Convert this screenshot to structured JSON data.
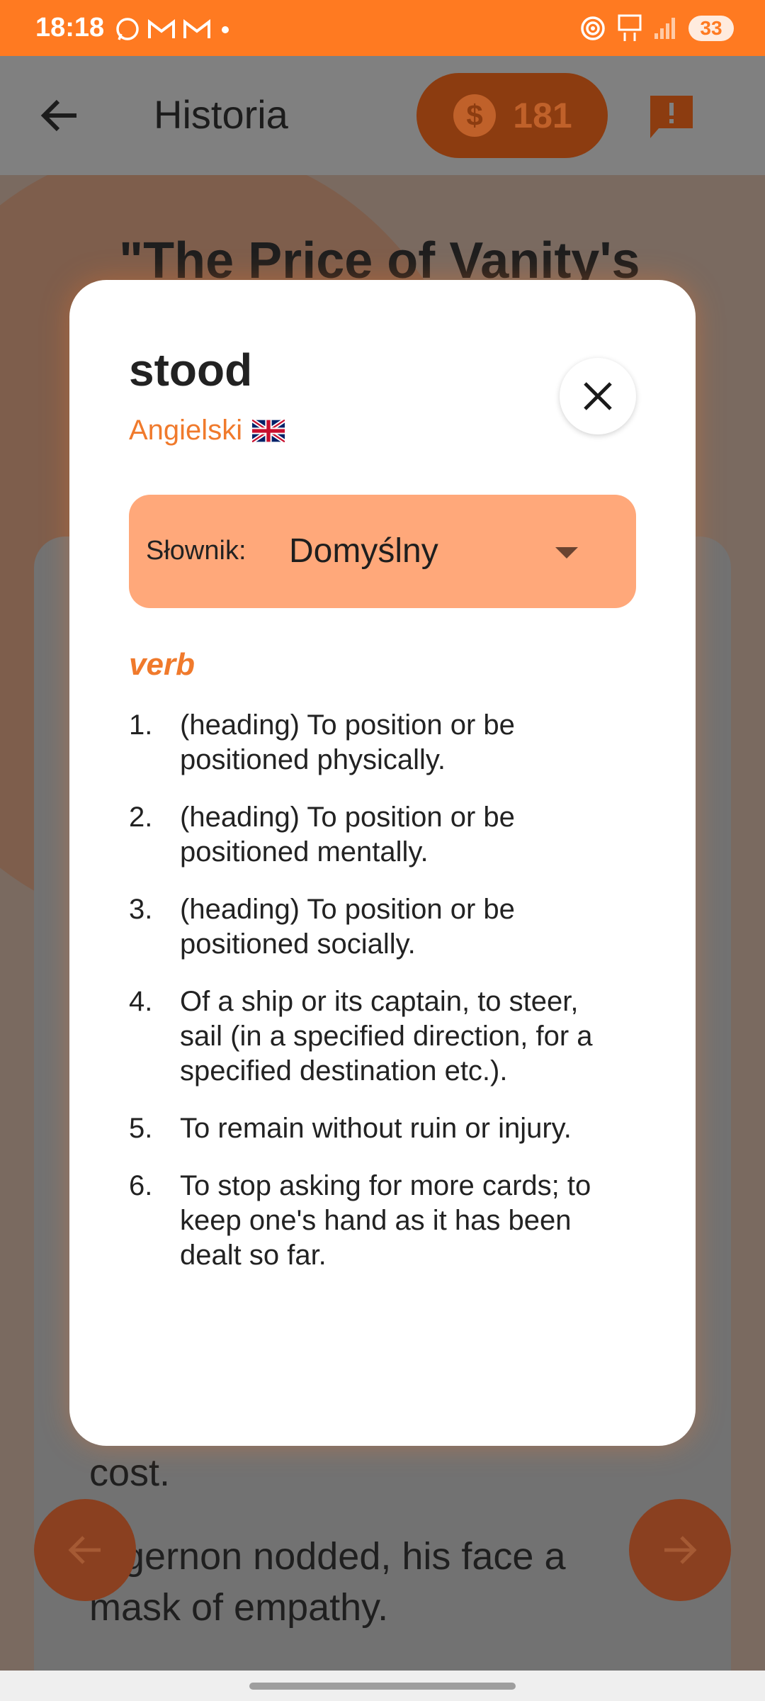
{
  "status_bar": {
    "time": "18:18",
    "battery": "33"
  },
  "app_bar": {
    "title": "Historia",
    "coins": "181"
  },
  "background": {
    "story_title": "\"The Price of Vanity's",
    "text_line_1": "cost.",
    "text_line_2": "Algernon nodded, his face a",
    "text_line_3": "mask of empathy."
  },
  "dialog": {
    "word": "stood",
    "language": "Angielski",
    "dictionary": {
      "label": "Słownik:",
      "value": "Domyślny"
    },
    "part_of_speech": "verb",
    "definitions": [
      {
        "num": "1.",
        "text": "(heading) To position or be positioned physically."
      },
      {
        "num": "2.",
        "text": "(heading) To position or be positioned mentally."
      },
      {
        "num": "3.",
        "text": "(heading) To position or be positioned socially."
      },
      {
        "num": "4.",
        "text": "Of a ship or its captain, to steer, sail (in a specified direction, for a specified destination etc.)."
      },
      {
        "num": "5.",
        "text": "To remain without ruin or injury."
      },
      {
        "num": "6.",
        "text": "To stop asking for more cards; to keep one's hand as it has been dealt so far."
      }
    ]
  },
  "colors": {
    "accent": "#ff7a21",
    "dictionary_bg": "#ffa87a",
    "accent_text": "#f07a2c"
  }
}
